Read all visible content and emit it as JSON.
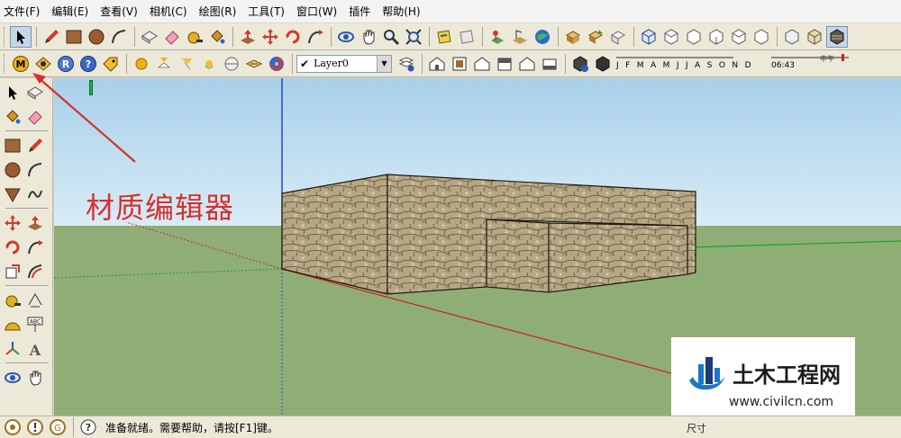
{
  "menu": [
    {
      "id": "file",
      "label": "文件(F)"
    },
    {
      "id": "edit",
      "label": "编辑(E)"
    },
    {
      "id": "view",
      "label": "查看(V)"
    },
    {
      "id": "camera",
      "label": "相机(C)"
    },
    {
      "id": "draw",
      "label": "绘图(R)"
    },
    {
      "id": "tools",
      "label": "工具(T)"
    },
    {
      "id": "window",
      "label": "窗口(W)"
    },
    {
      "id": "plugins",
      "label": "插件"
    },
    {
      "id": "help",
      "label": "帮助(H)"
    }
  ],
  "layer": {
    "checked": "✔",
    "value": "Layer0",
    "dropdown": "▼"
  },
  "shadow": {
    "months": "J F M A M J J A S O N D",
    "time": "06:43",
    "noon": "中午"
  },
  "annotation": {
    "text": "材质编辑器"
  },
  "watermark": {
    "title": "土木工程网",
    "url": "www.civilcn.com"
  },
  "status": {
    "text": "准备就绪。需要帮助，请按[F1]键。",
    "right_label": "尺寸"
  },
  "colors": {
    "sky": "#b7d8ec",
    "ground": "#8fae76",
    "accent_red": "#d7302c",
    "stone": "#b9a98a"
  },
  "icons": {
    "toolbar1": [
      "select-arrow-icon",
      "pencil-icon",
      "rectangle-icon",
      "circle-icon",
      "arc-icon",
      "make-component-icon",
      "eraser-icon",
      "tape-measure-icon",
      "paint-bucket-icon",
      "push-pull-icon",
      "move-icon",
      "rotate-icon",
      "follow-me-icon",
      "orbit-icon",
      "pan-icon",
      "zoom-icon",
      "zoom-extents-icon",
      "section-plane-icon",
      "section-display-icon",
      "add-location-icon",
      "toggle-terrain-icon",
      "google-earth-icon",
      "get-models-icon",
      "share-model-icon",
      "share-component-icon",
      "iso-view-icon",
      "top-view-icon",
      "front-view-icon",
      "right-view-icon",
      "back-view-icon",
      "left-view-icon",
      "xray-icon",
      "wireframe-icon",
      "hidden-line-icon",
      "shaded-icon",
      "shaded-textures-icon",
      "monochrome-icon"
    ],
    "toolbar2": [
      "material-editor-icon",
      "object-library-icon",
      "render-icon",
      "help-icon",
      "tag-icon",
      "sphere-light-icon",
      "spot-light-icon",
      "area-light-icon",
      "ies-light-icon",
      "sky-dome-icon",
      "sun-icon",
      "spiral-logo-icon",
      "layer-manager-icon",
      "iso-house-icon",
      "top-house-icon",
      "front-house-icon",
      "right-house-icon",
      "back-house-icon",
      "left-house-icon",
      "shadow-settings-icon",
      "shadow-toggle-icon"
    ]
  }
}
